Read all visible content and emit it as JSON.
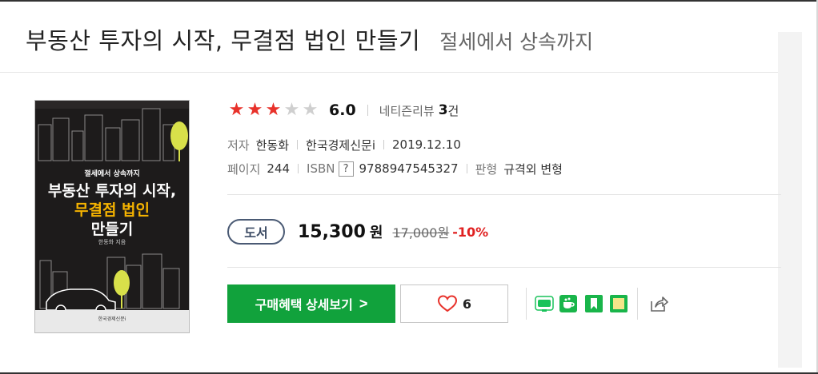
{
  "book": {
    "title": "부동산 투자의 시작, 무결점 법인 만들기",
    "subtitle": "절세에서 상속까지"
  },
  "cover": {
    "small_text": "절세에서 상속까지",
    "line1": "부동산 투자의 시작,",
    "line2": "무결점 법인",
    "line3": "만들기",
    "author": "한동화 지음",
    "publisher": "한국경제신문i"
  },
  "rating": {
    "stars_filled": 3,
    "stars_total": 5,
    "score": "6.0",
    "review_label": "네티즌리뷰",
    "review_count": "3",
    "review_unit": "건"
  },
  "meta": {
    "author_label": "저자",
    "author": "한동화",
    "publisher": "한국경제신문i",
    "date": "2019.12.10",
    "pages_label": "페이지",
    "pages": "244",
    "isbn_label": "ISBN",
    "isbn_help": "?",
    "isbn": "9788947545327",
    "format_label": "판형",
    "format": "규격외 변형"
  },
  "price": {
    "badge": "도서",
    "sale_price": "15,300",
    "unit": "원",
    "original_price": "17,000원",
    "discount": "-10%"
  },
  "actions": {
    "benefit_button": "구매혜택 상세보기",
    "benefit_chevron": ">",
    "like_count": "6"
  },
  "share": {
    "icons": [
      "blog-icon",
      "cafe-icon",
      "bookmark-icon",
      "memo-icon",
      "share-icon"
    ]
  },
  "colors": {
    "star_on": "#e8322b",
    "green": "#11a23c",
    "discount": "#e02020",
    "badge": "#3b4a63"
  }
}
